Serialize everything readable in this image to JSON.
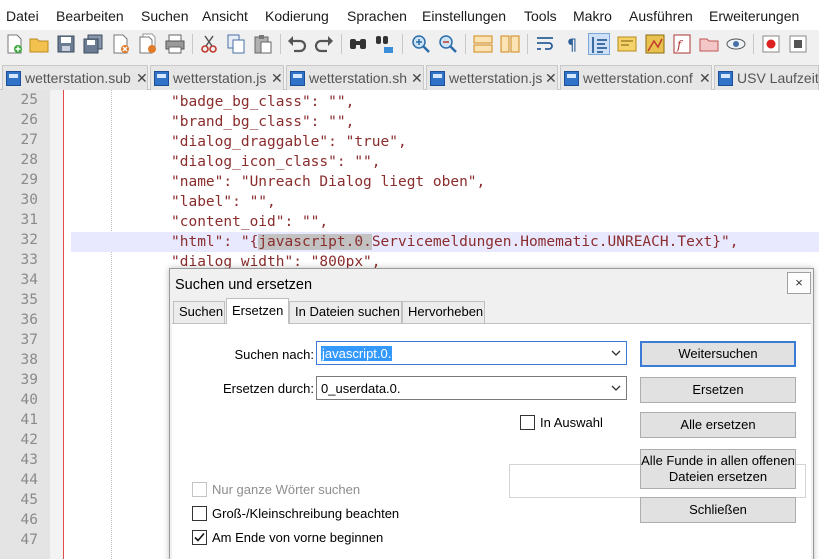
{
  "menu": [
    "Datei",
    "Bearbeiten",
    "Suchen",
    "Ansicht",
    "Kodierung",
    "Sprachen",
    "Einstellungen",
    "Tools",
    "Makro",
    "Ausführen",
    "Erweiterungen"
  ],
  "toolbar_icons": [
    "new-file-icon",
    "open-file-icon",
    "save-icon",
    "save-all-icon",
    "close-icon",
    "close-all-icon",
    "print-icon",
    "cut-icon",
    "copy-icon",
    "paste-icon",
    "undo-icon",
    "redo-icon",
    "find-icon",
    "replace-icon",
    "zoom-in-icon",
    "zoom-out-icon",
    "sync-vertical-icon",
    "sync-horizontal-icon",
    "word-wrap-icon",
    "show-all-chars-icon",
    "indent-guide-icon",
    "language-icon",
    "map-icon",
    "function-list-icon",
    "folder-workspace-icon",
    "monitor-icon",
    "record-macro-icon",
    "stop-macro-icon"
  ],
  "tabs": [
    {
      "label": "wetterstation.sub"
    },
    {
      "label": "wetterstation.js"
    },
    {
      "label": "wetterstation.sh"
    },
    {
      "label": "wetterstation.js"
    },
    {
      "label": "wetterstation.conf"
    },
    {
      "label": "USV Laufzeit.txt"
    }
  ],
  "editor": {
    "line_numbers": [
      "25",
      "26",
      "27",
      "28",
      "29",
      "30",
      "31",
      "32",
      "33",
      "34",
      "35",
      "36",
      "37",
      "38",
      "39",
      "40",
      "41",
      "42",
      "43",
      "44",
      "45",
      "46",
      "47"
    ],
    "current_line": "32",
    "lines": [
      {
        "pre": "\"badge_bg_class\": \"\",",
        "hl": "",
        "post": ""
      },
      {
        "pre": "\"brand_bg_class\": \"\",",
        "hl": "",
        "post": ""
      },
      {
        "pre": "\"dialog_draggable\": \"true\",",
        "hl": "",
        "post": ""
      },
      {
        "pre": "\"dialog_icon_class\": \"\",",
        "hl": "",
        "post": ""
      },
      {
        "pre": "\"name\": \"Unreach Dialog liegt oben\",",
        "hl": "",
        "post": ""
      },
      {
        "pre": "\"label\": \"\",",
        "hl": "",
        "post": ""
      },
      {
        "pre": "\"content_oid\": \"\",",
        "hl": "",
        "post": ""
      },
      {
        "pre": "\"html\": \"{",
        "hl": "javascript.0.",
        "post": "Servicemeldungen.Homematic.UNREACH.Text}\","
      },
      {
        "pre": "\"dialog_width\": \"800px\",",
        "hl": "",
        "post": ""
      }
    ]
  },
  "dialog": {
    "title": "Suchen und ersetzen",
    "close_label": "×",
    "tabs": [
      "Suchen",
      "Ersetzen",
      "In Dateien suchen",
      "Hervorheben"
    ],
    "active_tab": "Ersetzen",
    "search_label": "Suchen nach:",
    "search_value": "javascript.0.",
    "replace_label": "Ersetzen durch:",
    "replace_value": "0_userdata.0.",
    "in_selection_label": "In Auswahl",
    "in_selection_checked": false,
    "buttons": {
      "find_next": "Weitersuchen",
      "replace": "Ersetzen",
      "replace_all": "Alle ersetzen",
      "replace_all_open_line1": "Alle Funde in allen offenen",
      "replace_all_open_line2": "Dateien ersetzen",
      "close": "Schließen"
    },
    "options": {
      "whole_word": {
        "label": "Nur ganze Wörter suchen",
        "checked": false,
        "enabled": false
      },
      "match_case": {
        "label": "Groß-/Kleinschreibung beachten",
        "checked": false,
        "enabled": true
      },
      "wrap_around": {
        "label": "Am Ende von vorne beginnen",
        "checked": true,
        "enabled": true
      }
    }
  },
  "colors": {
    "string_text": "#8a2d2d",
    "current_line_bg": "#e8e8ff",
    "selection_bg": "#3399ff",
    "accent": "#3a7bd5",
    "tab_icon": "#2f72c7"
  }
}
